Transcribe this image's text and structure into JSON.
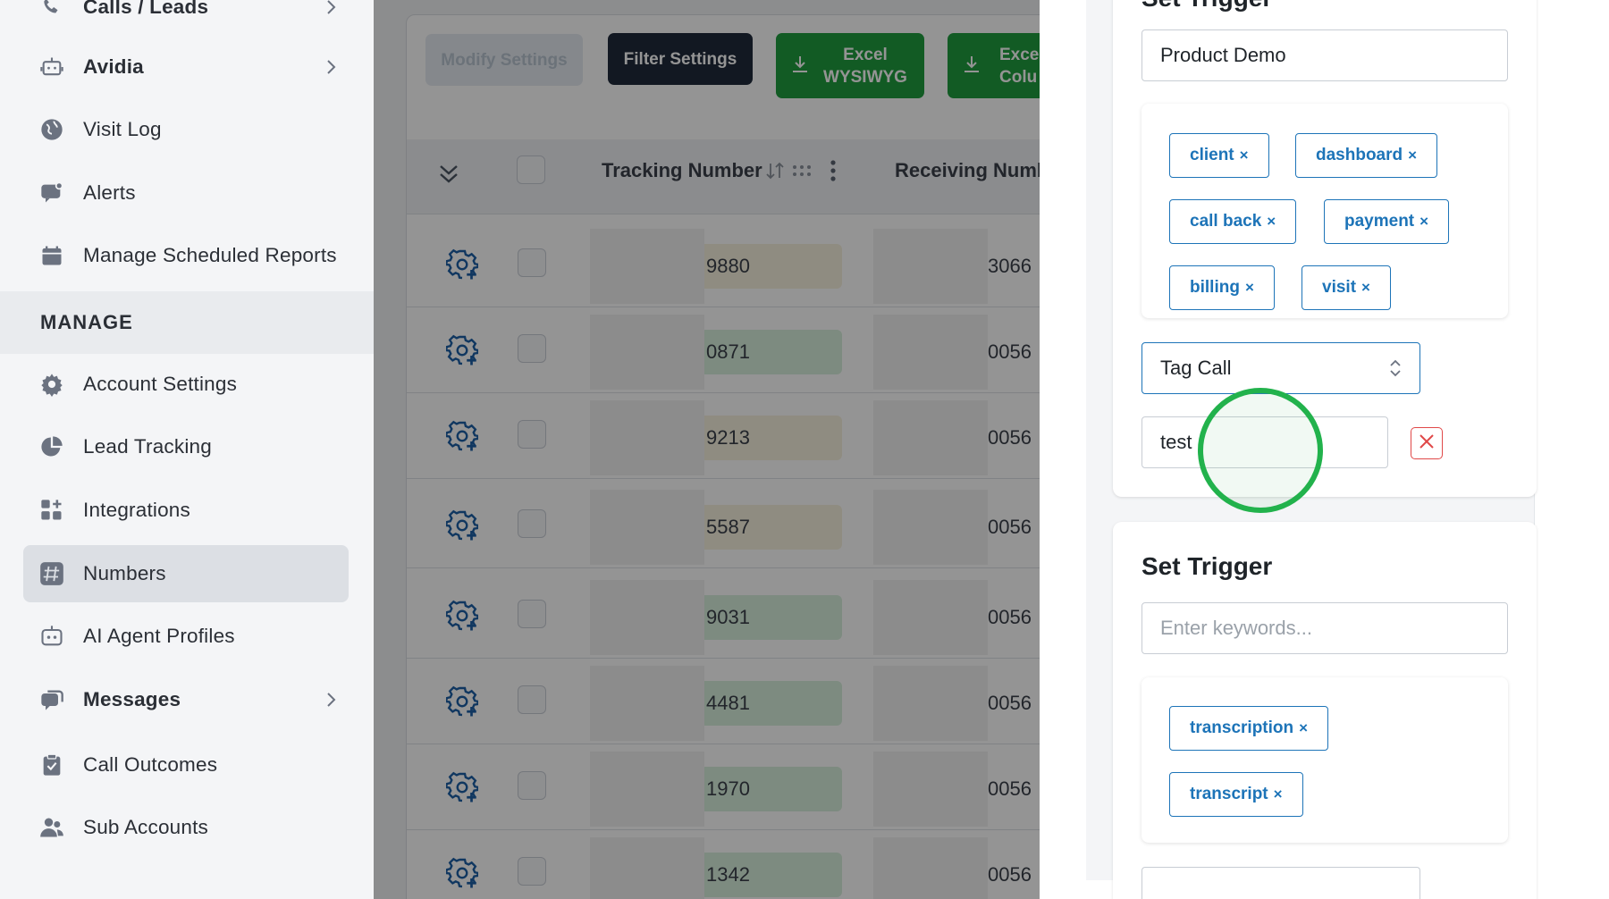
{
  "sidebar": {
    "items": [
      {
        "label": "Calls / Leads",
        "icon": "phone-icon",
        "bold": true,
        "chevron": true
      },
      {
        "label": "Avidia",
        "icon": "robot-icon",
        "bold": true,
        "chevron": true
      },
      {
        "label": "Visit Log",
        "icon": "globe-icon",
        "bold": false,
        "chevron": false
      },
      {
        "label": "Alerts",
        "icon": "chat-alert-icon",
        "bold": false,
        "chevron": false
      },
      {
        "label": "Manage Scheduled Reports",
        "icon": "calendar-icon",
        "bold": false,
        "chevron": false
      }
    ],
    "section_label": "MANAGE",
    "manage_items": [
      {
        "label": "Account Settings",
        "icon": "gear-icon"
      },
      {
        "label": "Lead Tracking",
        "icon": "pie-chart-icon"
      },
      {
        "label": "Integrations",
        "icon": "grid-plus-icon"
      },
      {
        "label": "Numbers",
        "icon": "hash-icon",
        "active": true
      },
      {
        "label": "AI Agent Profiles",
        "icon": "bot-face-icon"
      },
      {
        "label": "Messages",
        "icon": "chat-bubbles-icon",
        "bold": true,
        "chevron": true
      },
      {
        "label": "Call Outcomes",
        "icon": "clipboard-icon"
      },
      {
        "label": "Sub Accounts",
        "icon": "users-icon"
      }
    ]
  },
  "toolbar": {
    "modify_label": "Modify Settings",
    "filter_label": "Filter Settings",
    "excel_wysiwyg_line1": "Excel",
    "excel_wysiwyg_line2": "WYSIWYG",
    "excel_columns_line1": "Exce",
    "excel_columns_line2": "Colu"
  },
  "table": {
    "headers": {
      "tracking": "Tracking Number",
      "receiving": "Receiving Numb"
    },
    "rows": [
      {
        "tracking_suffix": "9880",
        "receiving_suffix": "3066",
        "pill_color": "#f6f1de"
      },
      {
        "tracking_suffix": "0871",
        "receiving_suffix": "0056",
        "pill_color": "#d8f0dc"
      },
      {
        "tracking_suffix": "9213",
        "receiving_suffix": "0056",
        "pill_color": "#f6f1de"
      },
      {
        "tracking_suffix": "5587",
        "receiving_suffix": "0056",
        "pill_color": "#f6f1de"
      },
      {
        "tracking_suffix": "9031",
        "receiving_suffix": "0056",
        "pill_color": "#d8f0dc"
      },
      {
        "tracking_suffix": "4481",
        "receiving_suffix": "0056",
        "pill_color": "#d8f0dc"
      },
      {
        "tracking_suffix": "1970",
        "receiving_suffix": "0056",
        "pill_color": "#d8f0dc"
      },
      {
        "tracking_suffix": "1342",
        "receiving_suffix": "0056",
        "pill_color": "#d8f0dc"
      }
    ]
  },
  "drawer": {
    "trigger1": {
      "title": "Set Trigger",
      "input_value": "Product Demo",
      "tags": [
        "client",
        "dashboard",
        "call back",
        "payment",
        "billing",
        "visit"
      ],
      "action_select": "Tag Call",
      "action_value": "test"
    },
    "trigger2": {
      "title": "Set Trigger",
      "input_placeholder": "Enter keywords...",
      "tags": [
        "transcription",
        "transcript"
      ]
    },
    "tag_remove_glyph": "×"
  },
  "colors": {
    "accent": "#1d74b8",
    "excel_green": "#1f9d3e",
    "filter_dark": "#1f2a3b",
    "click_indicator": "#22b24c",
    "delete_red": "#e04848"
  }
}
